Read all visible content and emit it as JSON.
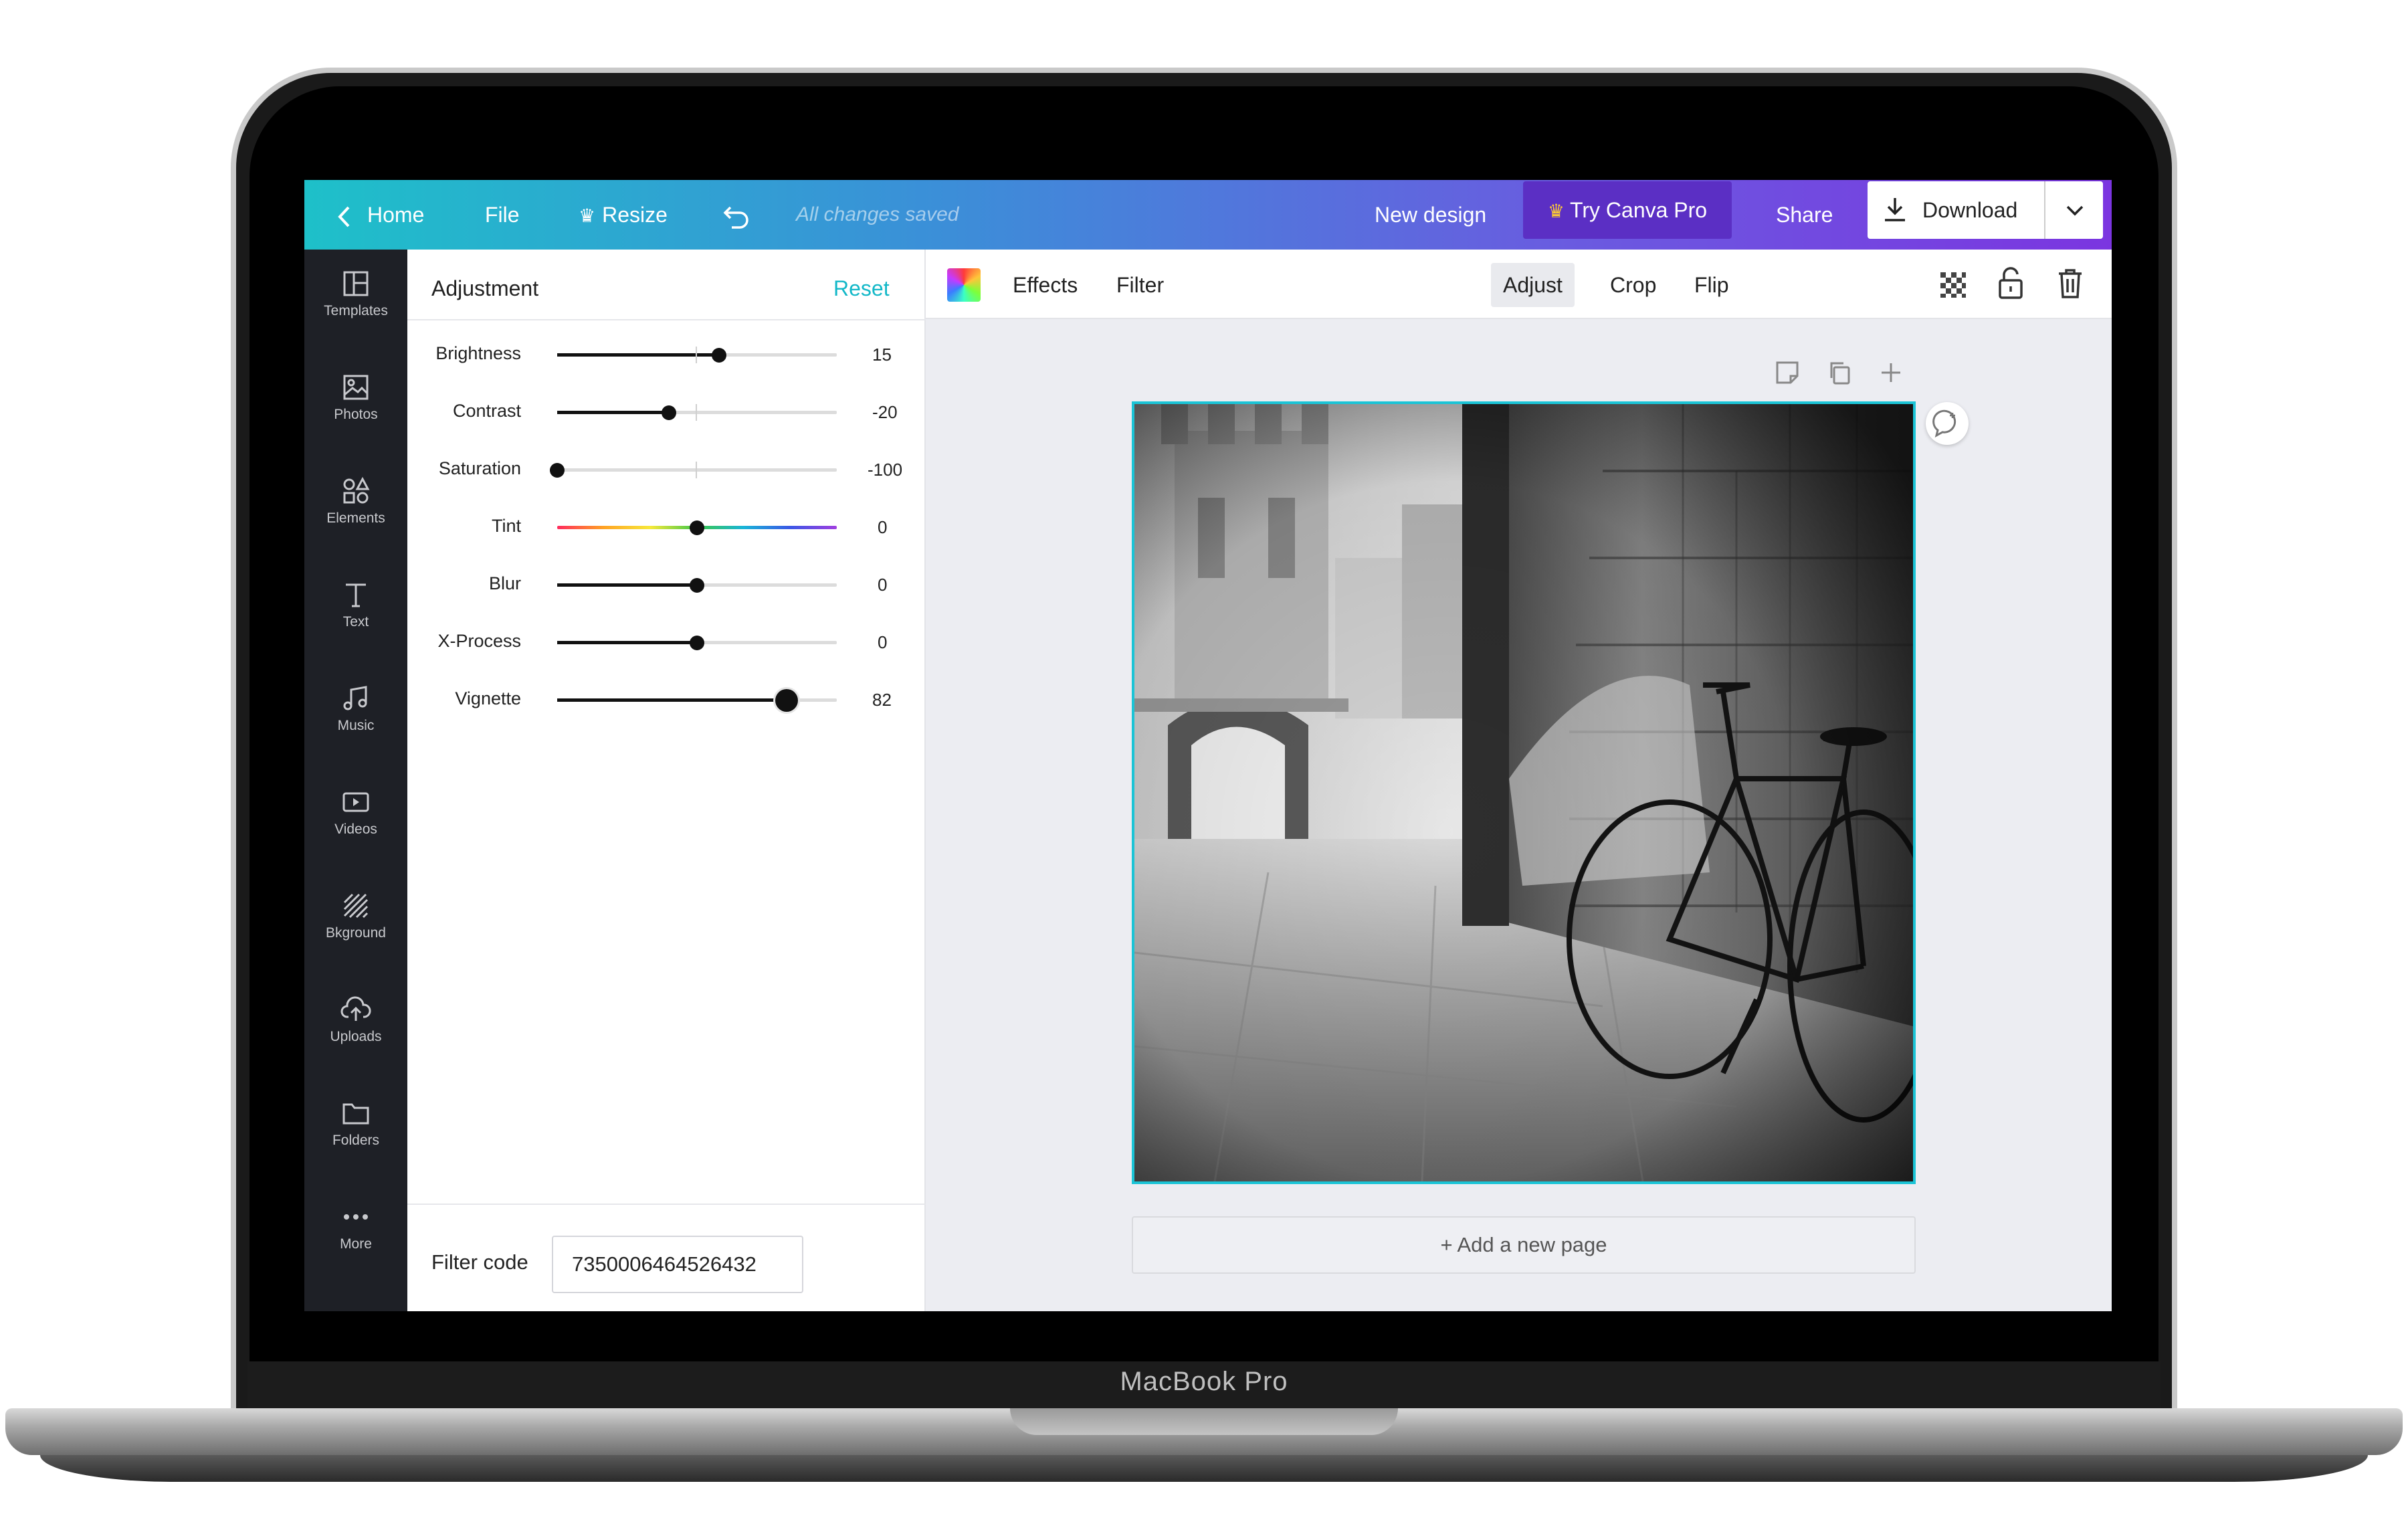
{
  "device": {
    "label": "MacBook Pro"
  },
  "topbar": {
    "home": "Home",
    "file": "File",
    "resize": "Resize",
    "status": "All changes saved",
    "new_design": "New design",
    "try_pro": "Try Canva Pro",
    "share": "Share",
    "download": "Download"
  },
  "sidebar": {
    "items": [
      {
        "label": "Templates",
        "icon": "templates-icon"
      },
      {
        "label": "Photos",
        "icon": "photos-icon"
      },
      {
        "label": "Elements",
        "icon": "elements-icon"
      },
      {
        "label": "Text",
        "icon": "text-icon"
      },
      {
        "label": "Music",
        "icon": "music-icon"
      },
      {
        "label": "Videos",
        "icon": "videos-icon"
      },
      {
        "label": "Bkground",
        "icon": "background-icon"
      },
      {
        "label": "Uploads",
        "icon": "uploads-icon"
      },
      {
        "label": "Folders",
        "icon": "folders-icon"
      },
      {
        "label": "More",
        "icon": "more-icon"
      }
    ]
  },
  "panel": {
    "title": "Adjustment",
    "reset": "Reset",
    "adjustments": [
      {
        "label": "Brightness",
        "value": "15"
      },
      {
        "label": "Contrast",
        "value": "-20"
      },
      {
        "label": "Saturation",
        "value": "-100"
      },
      {
        "label": "Tint",
        "value": "0"
      },
      {
        "label": "Blur",
        "value": "0"
      },
      {
        "label": "X-Process",
        "value": "0"
      },
      {
        "label": "Vignette",
        "value": "82"
      }
    ],
    "filter_code_label": "Filter code",
    "filter_code_value": "7350006464526432"
  },
  "toolbar": {
    "effects": "Effects",
    "filter": "Filter",
    "adjust": "Adjust",
    "crop": "Crop",
    "flip": "Flip"
  },
  "canvas": {
    "add_page": "+ Add a new page"
  },
  "colors": {
    "accent": "#13b8c8",
    "pro_button": "#5b2fc4",
    "rail": "#1e2026"
  }
}
